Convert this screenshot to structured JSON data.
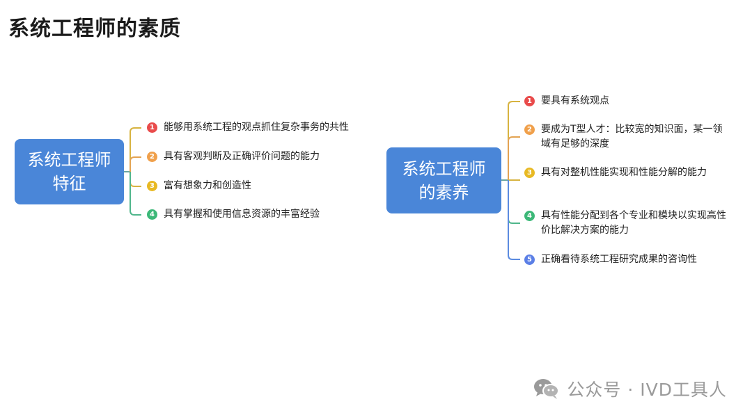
{
  "page_title": "系统工程师的素质",
  "left_map": {
    "root": "系统工程师特征",
    "items": [
      {
        "num": "1",
        "color": "#e94b4b",
        "text": "能够用系统工程的观点抓住复杂事务的共性"
      },
      {
        "num": "2",
        "color": "#f0a04b",
        "text": "具有客观判断及正确评价问题的能力"
      },
      {
        "num": "3",
        "color": "#e8b923",
        "text": "富有想象力和创造性"
      },
      {
        "num": "4",
        "color": "#3cb878",
        "text": "具有掌握和使用信息资源的丰富经验"
      }
    ]
  },
  "right_map": {
    "root": "系统工程师的素养",
    "items": [
      {
        "num": "1",
        "color": "#e94b4b",
        "text": "要具有系统观点"
      },
      {
        "num": "2",
        "color": "#f0a04b",
        "text": "要成为T型人才：比较宽的知识面，某一领域有足够的深度"
      },
      {
        "num": "3",
        "color": "#e8b923",
        "text": "具有对整机性能实现和性能分解的能力"
      },
      {
        "num": "4",
        "color": "#3cb878",
        "text": "具有性能分配到各个专业和模块以实现高性价比解决方案的能力"
      },
      {
        "num": "5",
        "color": "#5b7fe6",
        "text": "正确看待系统工程研究成果的咨询性"
      }
    ]
  },
  "watermark": {
    "icon": "wechat-icon",
    "text": "公众号 · IVD工具人"
  }
}
